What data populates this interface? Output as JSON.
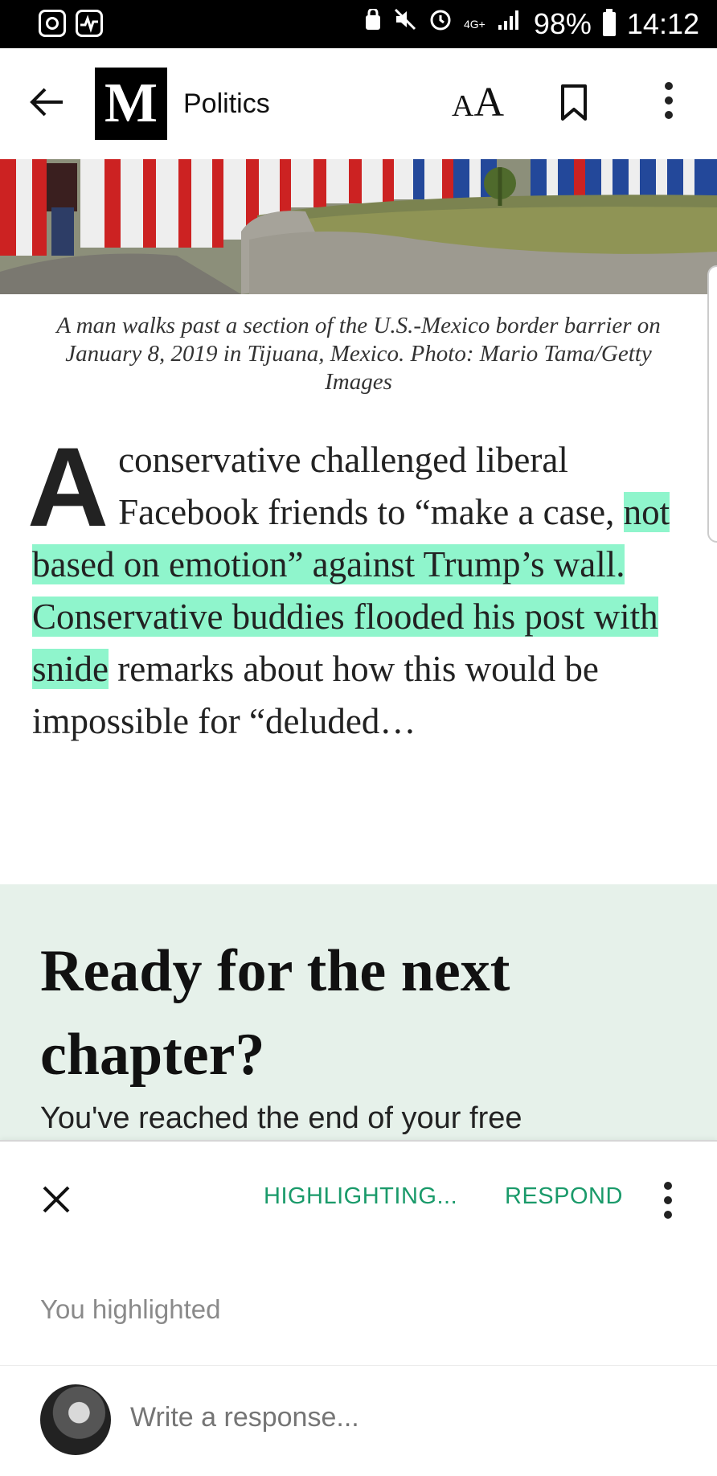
{
  "status_bar": {
    "icons_left": [
      "app-notification-icon",
      "activity-monitor-icon"
    ],
    "icons_right": [
      "secure-folder-icon",
      "mute-icon",
      "alarm-icon",
      "signal-icon"
    ],
    "network": "4G+",
    "battery": "98%",
    "time": "14:12"
  },
  "app_bar": {
    "logo": "M",
    "section": "Politics",
    "font_size_small": "A",
    "font_size_large": "A"
  },
  "article": {
    "caption": "A man walks past a section of the U.S.-Mexico border barrier on January 8, 2019 in Tijuana, Mexico. Photo: Mario Tama/Getty Images",
    "dropcap": "A",
    "text_before": " conservative challenged liberal Facebook friends to “make a case, ",
    "highlighted": "not based on emotion” against Trump’s wall. Conservative buddies flooded his post with snide",
    "text_after": " remarks about how this would be impossible for “deluded…"
  },
  "paywall": {
    "title": "Ready for the next chapter?",
    "subtitle": "You've reached the end of your free"
  },
  "highlight_sheet": {
    "highlighting_label": "HIGHLIGHTING...",
    "respond_label": "RESPOND",
    "you_highlighted": "You highlighted",
    "response_placeholder": "Write a response...",
    "accent_color": "#1a9a6a",
    "highlight_color": "#8ff5cc"
  }
}
